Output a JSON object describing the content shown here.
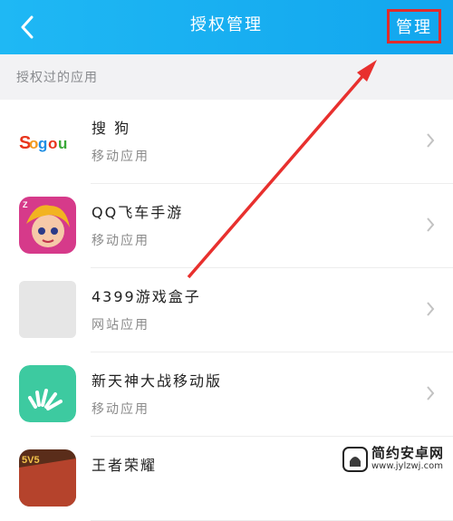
{
  "header": {
    "title": "授权管理",
    "manage_label": "管理",
    "bg_color": "#14aaf0",
    "highlight_color": "#e22b2b"
  },
  "section": {
    "label": "授权过的应用"
  },
  "apps": [
    {
      "name": "搜 狗",
      "type": "移动应用",
      "icon": "sogou-logo"
    },
    {
      "name": "QQ飞车手游",
      "type": "移动应用",
      "icon": "game-character-icon"
    },
    {
      "name": "4399游戏盒子",
      "type": "网站应用",
      "icon": "placeholder-icon"
    },
    {
      "name": "新天神大战移动版",
      "type": "移动应用",
      "icon": "green-app-icon"
    },
    {
      "name": "王者荣耀",
      "type": "",
      "icon": "game-icon"
    }
  ],
  "watermark": {
    "main": "简约安卓网",
    "url": "www.jylzwj.com"
  }
}
